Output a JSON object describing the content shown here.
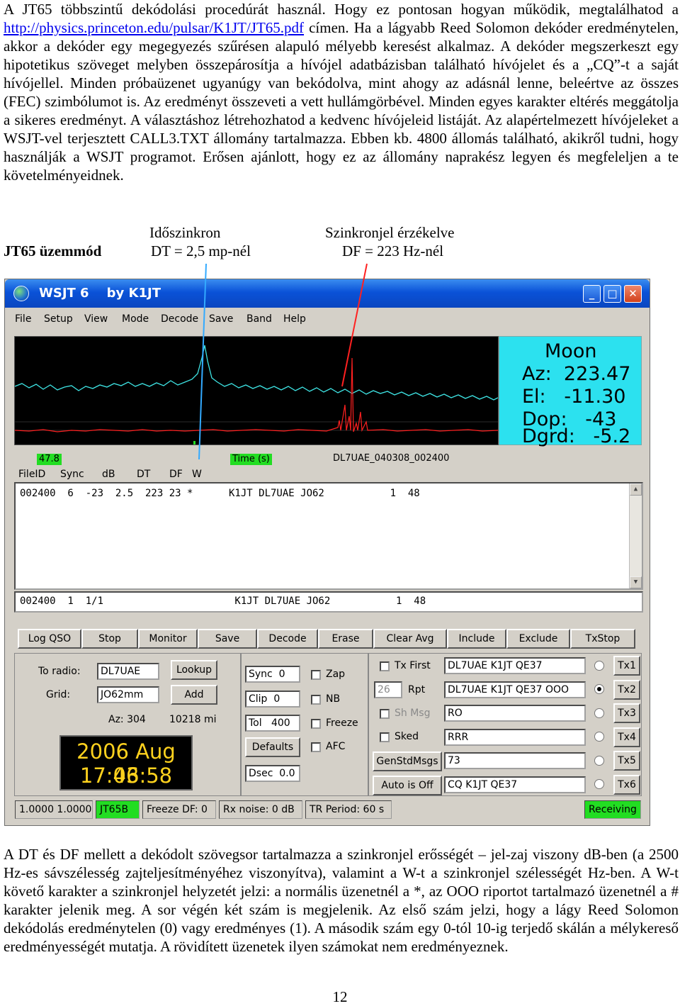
{
  "paragraph1": {
    "before_link": "A JT65 többszintű dekódolási procedúrát használ. Hogy ez pontosan hogyan működik, megtalálhatod a ",
    "link": "http://physics.princeton.edu/pulsar/K1JT/JT65.pdf",
    "after_link": " címen. Ha a lágyabb Reed Solomon dekóder eredménytelen, akkor a dekóder egy megegyezés szűrésen alapuló mélyebb keresést alkalmaz. A dekóder megszerkeszt egy hipotetikus szöveget melyben összepárosítja a hívójel adatbázisban található hívójelet és a „CQ”-t a saját hívójellel. Minden próbaüzenet ugyanúgy van bekódolva, mint ahogy az adásnál lenne, beleértve az összes (FEC) szimbólumot is. Az eredményt összeveti a vett hullámgörbével. Minden egyes karakter eltérés meggátolja a sikeres eredményt. A választáshoz létrehozhatod a kedvenc hívójeleid listáját. Az alapértelmezett hívójeleket a WSJT-vel terjesztett CALL3.TXT állomány tartalmazza. Ebben kb. 4800 állomás található, akikről tudni, hogy használják a WSJT programot. Erősen ajánlott, hogy ez az állomány naprakész legyen és megfeleljen a te követelményeidnek."
  },
  "captions": {
    "mode": "JT65 üzemmód",
    "sync_title": "Időszinkron",
    "sync_value": "DT = 2,5 mp-nél",
    "detect_title": "Szinkronjel érzékelve",
    "detect_value": "DF = 223 Hz-nél"
  },
  "window": {
    "title": "WSJT 6    by K1JT",
    "menu": [
      "File",
      "Setup",
      "View",
      "Mode",
      "Decode",
      "Save",
      "Band",
      "Help"
    ],
    "moon": {
      "title": "Moon",
      "az": "Az:  223.47",
      "el": "El:   -11.30",
      "dop": "Dop:   -43",
      "dgrd": "Dgrd:   -5.2"
    },
    "level": "47.8",
    "time_label": "Time (s)",
    "filename": "DL7UAE_040308_002400",
    "columns": [
      "FileID",
      "Sync",
      "dB",
      "DT",
      "DF",
      "W"
    ],
    "decoded_line": "002400  6  -23  2.5  223 23 *      K1JT DL7UAE JO62           1  48",
    "average_line": "002400  1  1/1                      K1JT DL7UAE JO62           1  48",
    "buttons": [
      "Log QSO",
      "Stop",
      "Monitor",
      "Save",
      "Decode",
      "Erase",
      "Clear Avg",
      "Include",
      "Exclude",
      "TxStop"
    ],
    "to_radio_label": "To radio:",
    "to_radio_value": "DL7UAE",
    "grid_label": "Grid:",
    "grid_value": "JO62mm",
    "lookup": "Lookup",
    "add": "Add",
    "az": "Az: 304",
    "distance": "10218 mi",
    "date": "2006 Aug 03",
    "time": "17:46:58",
    "sync": "Sync  0",
    "clip": "Clip  0",
    "tol": "Tol   400",
    "defaults": "Defaults",
    "dsec": "Dsec  0.0",
    "zap": "Zap",
    "nb": "NB",
    "freeze": "Freeze",
    "afc": "AFC",
    "tx_first": "Tx First",
    "rpt_value": "26",
    "rpt": "Rpt",
    "sh_msg": "Sh Msg",
    "sked": "Sked",
    "genstd": "GenStdMsgs",
    "auto": "Auto is Off",
    "tx_messages": [
      "DL7UAE K1JT QE37",
      "DL7UAE K1JT QE37 OOO",
      "RO",
      "RRR",
      "73",
      "CQ K1JT QE37"
    ],
    "tx_buttons": [
      "Tx1",
      "Tx2",
      "Tx3",
      "Tx4",
      "Tx5",
      "Tx6"
    ],
    "selected_tx": 2,
    "status": [
      "1.0000  1.0000",
      "JT65B",
      "Freeze DF:  0",
      "Rx noise:  0 dB",
      "TR Period: 60 s",
      "Receiving"
    ]
  },
  "paragraph2": "A DT és DF mellett a dekódolt szövegsor tartalmazza a szinkronjel erősségét – jel-zaj viszony dB-ben (a 2500 Hz-es sávszélesség zajteljesítményéhez viszonyítva), valamint a W-t a szinkronjel szélességét Hz-ben. A W-t követő karakter a szinkronjel helyzetét jelzi: a normális üzenetnél a *, az OOO riportot tartalmazó üzenetnél a # karakter jelenik meg. A sor végén két szám is megjelenik. Az első szám jelzi, hogy a lágy Reed Solomon dekódolás eredménytelen (0) vagy eredményes (1). A második szám egy 0-tól 10-ig terjedő skálán a mélykereső eredményességét mutatja. A rövidített üzenetek ilyen számokat nem eredményeznek.",
  "page_number": "12"
}
